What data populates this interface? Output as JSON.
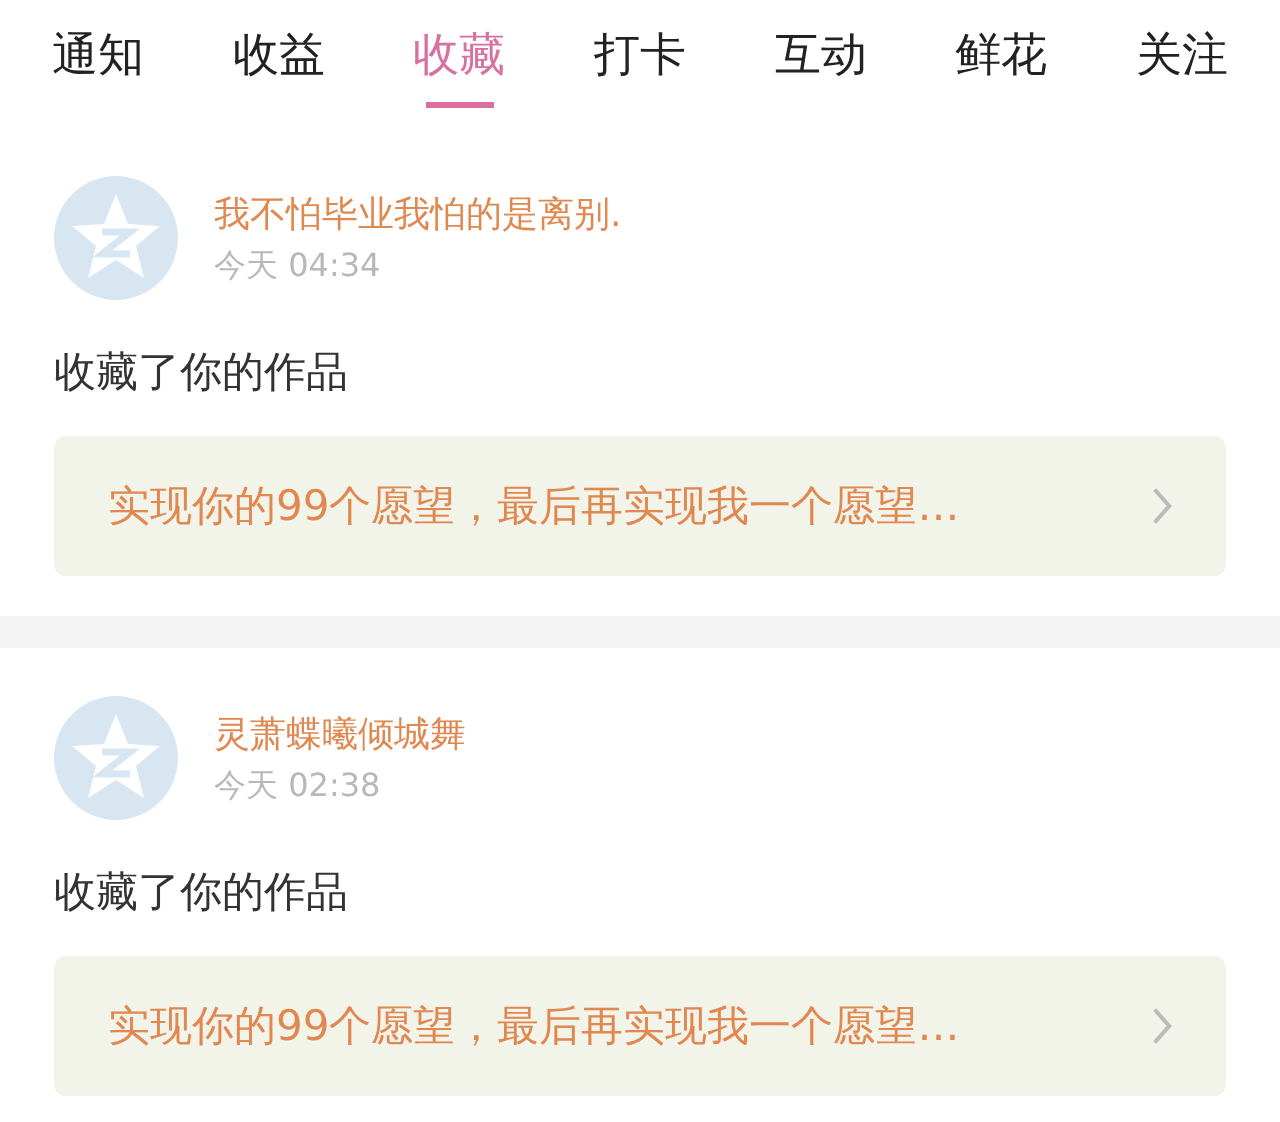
{
  "tabs": [
    {
      "label": "通知",
      "selected": false
    },
    {
      "label": "收益",
      "selected": false
    },
    {
      "label": "收藏",
      "selected": true
    },
    {
      "label": "打卡",
      "selected": false
    },
    {
      "label": "互动",
      "selected": false
    },
    {
      "label": "鲜花",
      "selected": false
    },
    {
      "label": "关注",
      "selected": false
    }
  ],
  "items": [
    {
      "name": "我不怕毕业我怕的是离别.",
      "time": "今天 04:34",
      "action": "收藏了你的作品",
      "work": "实现你的99个愿望，最后再实现我一个愿望…"
    },
    {
      "name": "灵萧蝶曦倾城舞",
      "time": "今天 02:38",
      "action": "收藏了你的作品",
      "work": "实现你的99个愿望，最后再实现我一个愿望…"
    }
  ]
}
